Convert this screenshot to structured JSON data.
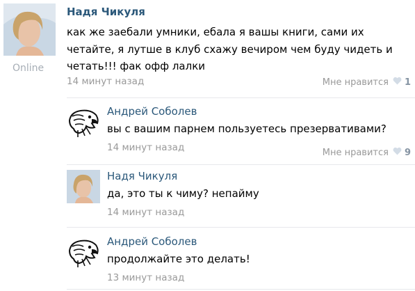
{
  "post": {
    "author": "Надя Чикуля",
    "status": "Online",
    "lines": [
      "как же заебали умники, ебала я вашы книги, сами их",
      "четайте, я лутше в клуб схажу вечиром чем буду чидеть и",
      "четать!!! фак офф лалки"
    ],
    "time": "14 минут назад",
    "like_label": "Мне нравится",
    "like_count": "1"
  },
  "comments": [
    {
      "author": "Андрей Соболев",
      "text": "вы с вашим парнем пользуетесь презервативами?",
      "time": "14 минут назад",
      "like_label": "Мне нравится",
      "like_count": "9"
    },
    {
      "author": "Надя Чикуля",
      "text": "да, это  ты к чиму? непайму",
      "time": "14 минут назад"
    },
    {
      "author": "Андрей Соболев",
      "text": "продолжайте это делать!",
      "time": "13 минут назад"
    }
  ],
  "colors": {
    "link": "#2b587a",
    "muted": "#999999",
    "divider": "#e7e8ec"
  },
  "icons": {
    "like": "heart-icon"
  }
}
